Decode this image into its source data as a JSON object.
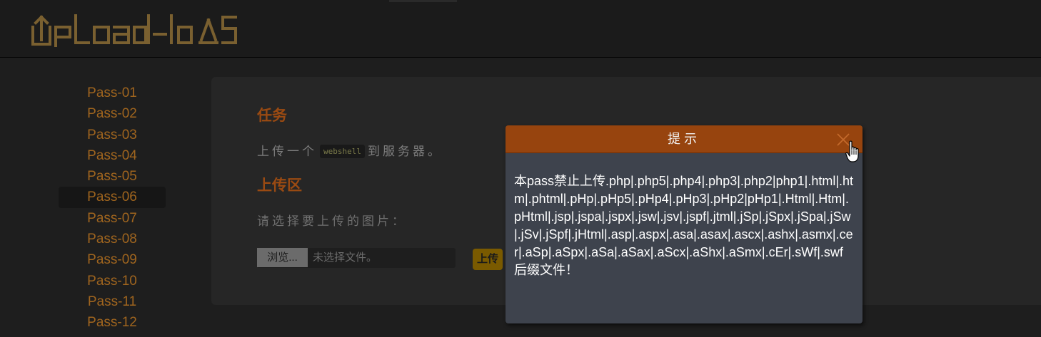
{
  "header": {
    "logo_text": "Upload-labs"
  },
  "sidebar": {
    "items": [
      {
        "label": "Pass-01"
      },
      {
        "label": "Pass-02"
      },
      {
        "label": "Pass-03"
      },
      {
        "label": "Pass-04"
      },
      {
        "label": "Pass-05"
      },
      {
        "label": "Pass-06",
        "active": true
      },
      {
        "label": "Pass-07"
      },
      {
        "label": "Pass-08"
      },
      {
        "label": "Pass-09"
      },
      {
        "label": "Pass-10"
      },
      {
        "label": "Pass-11"
      },
      {
        "label": "Pass-12"
      }
    ]
  },
  "task": {
    "title": "任务",
    "desc_before": "上传一个",
    "desc_code": "webshell",
    "desc_after": "到服务器。"
  },
  "upload": {
    "title": "上传区",
    "label": "请选择要上传的图片：",
    "browse_label": "浏览...",
    "no_file_label": "未选择文件。",
    "submit_label": "上传"
  },
  "modal": {
    "title": "提示",
    "message": "本pass禁止上传.php|.php5|.php4|.php3|.php2|php1|.html|.htm|.phtml|.pHp|.pHp5|.pHp4|.pHp3|.pHp2|pHp1|.Html|.Htm|.pHtml|.jsp|.jspa|.jspx|.jsw|.jsv|.jspf|.jtml|.jSp|.jSpx|.jSpa|.jSw|.jSv|.jSpf|.jHtml|.asp|.aspx|.asa|.asax|.ascx|.ashx|.asmx|.cer|.aSp|.aSpx|.aSa|.aSax|.aScx|.aShx|.aSmx|.cEr|.sWf|.swf后缀文件！"
  },
  "colors": {
    "accent": "#97440e",
    "sidebar_text": "#a0651e",
    "logo": "#7a6030"
  },
  "icons": {
    "close": "close-icon",
    "cursor": "hand-pointer-icon"
  }
}
